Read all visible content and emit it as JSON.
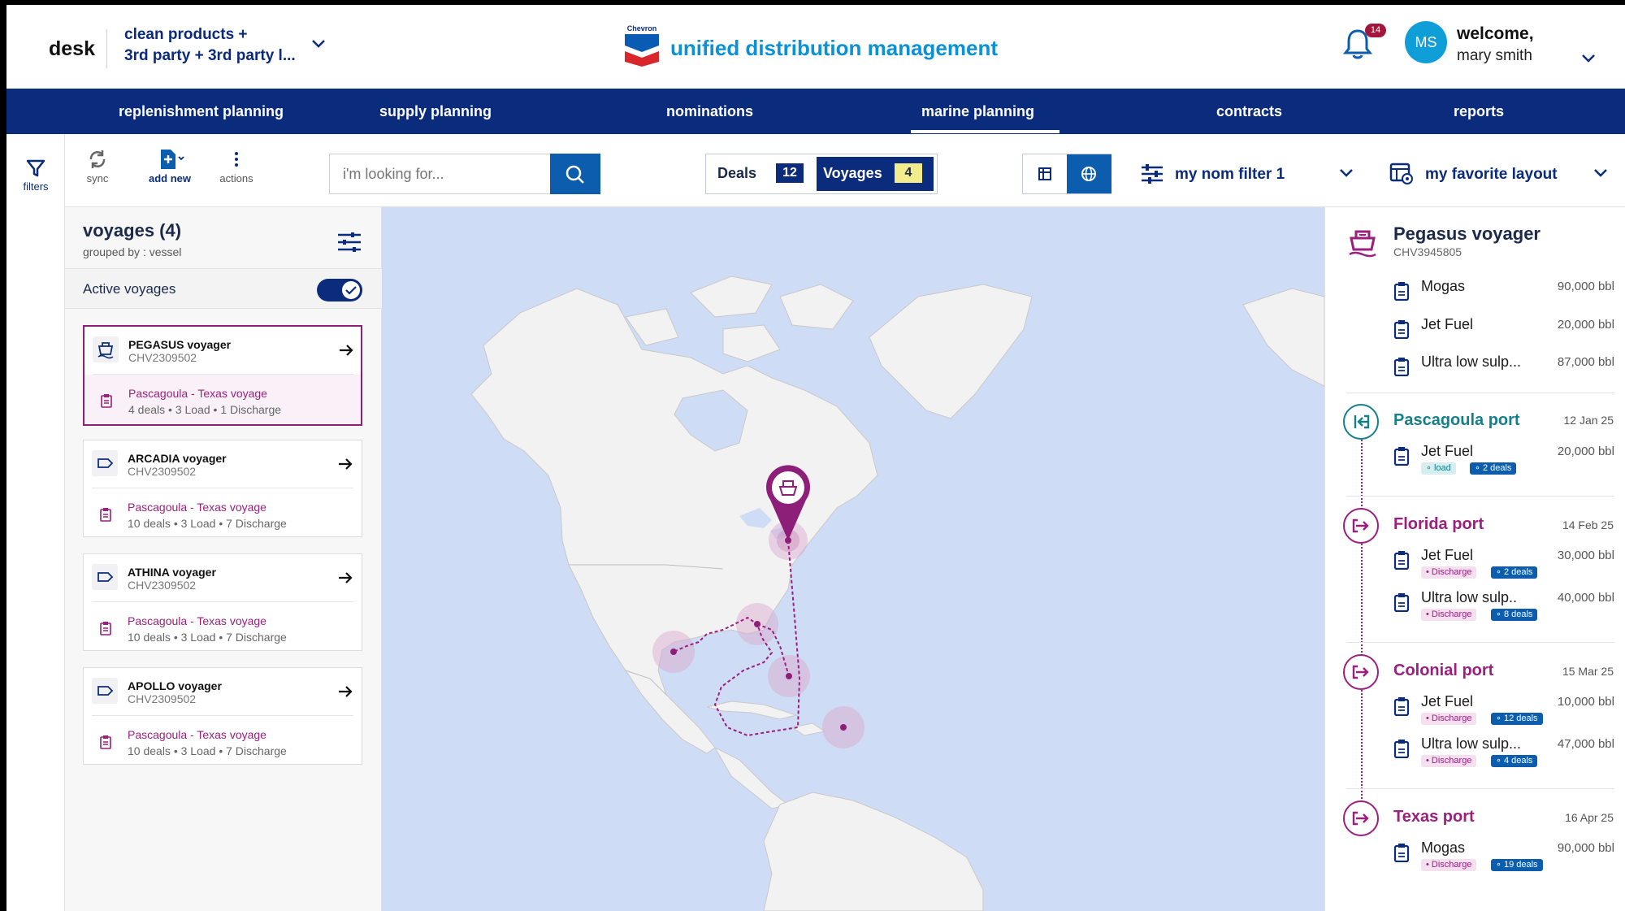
{
  "header": {
    "desk_label": "desk",
    "workspace_line1": "clean products +",
    "workspace_line2": "3rd party + 3rd party l...",
    "brand_small": "Chevron",
    "app_title": "unified distribution management",
    "notification_count": "14",
    "avatar_initials": "MS",
    "welcome_label": "welcome,",
    "user_name": "mary smith"
  },
  "nav": {
    "items": [
      {
        "label": "replenishment planning"
      },
      {
        "label": "supply planning"
      },
      {
        "label": "nominations"
      },
      {
        "label": "marine planning"
      },
      {
        "label": "contracts"
      },
      {
        "label": "reports"
      }
    ],
    "active": "marine planning"
  },
  "rail": {
    "filters_label": "filters"
  },
  "toolbar": {
    "sync_label": "sync",
    "add_new_label": "add new",
    "actions_label": "actions",
    "search_placeholder": "i'm looking for...",
    "deals_label": "Deals",
    "deals_count": "12",
    "voyages_label": "Voyages",
    "voyages_count": "4",
    "filter_label": "my nom filter 1",
    "layout_label": "my favorite layout"
  },
  "left_panel": {
    "title": "voyages (4)",
    "subtitle": "grouped by : vessel",
    "active_label": "Active voyages",
    "active_on": true,
    "voyages": [
      {
        "name": "PEGASUS voyager",
        "id": "CHV2309502",
        "route": "Pascagoula - Texas voyage",
        "meta": "4 deals • 3 Load • 1 Discharge",
        "selected": true
      },
      {
        "name": "ARCADIA voyager",
        "id": "CHV2309502",
        "route": "Pascagoula - Texas voyage",
        "meta": "10 deals • 3 Load • 7 Discharge",
        "selected": false
      },
      {
        "name": "ATHINA voyager",
        "id": "CHV2309502",
        "route": "Pascagoula - Texas voyage",
        "meta": "10 deals • 3 Load • 7 Discharge",
        "selected": false
      },
      {
        "name": "APOLLO voyager",
        "id": "CHV2309502",
        "route": "Pascagoula - Texas voyage",
        "meta": "10 deals • 3 Load • 7 Discharge",
        "selected": false
      }
    ]
  },
  "right_panel": {
    "vessel_name": "Pegasus voyager",
    "vessel_id": "CHV3945805",
    "cargo": [
      {
        "product": "Mogas",
        "qty": "90,000 bbl"
      },
      {
        "product": "Jet Fuel",
        "qty": "20,000 bbl"
      },
      {
        "product": "Ultra low sulp...",
        "qty": "87,000 bbl"
      }
    ],
    "ports": [
      {
        "name": "Pascagoula port",
        "date": "12 Jan 25",
        "type": "load",
        "items": [
          {
            "product": "Jet Fuel",
            "qty": "20,000 bbl",
            "tag": "load",
            "deals": "2 deals"
          }
        ]
      },
      {
        "name": "Florida port",
        "date": "14 Feb 25",
        "type": "discharge",
        "items": [
          {
            "product": "Jet Fuel",
            "qty": "30,000 bbl",
            "tag": "Discharge",
            "deals": "2 deals"
          },
          {
            "product": "Ultra low sulp..",
            "qty": "40,000 bbl",
            "tag": "Discharge",
            "deals": "8 deals"
          }
        ]
      },
      {
        "name": "Colonial port",
        "date": "15 Mar 25",
        "type": "discharge",
        "items": [
          {
            "product": "Jet Fuel",
            "qty": "10,000 bbl",
            "tag": "Discharge",
            "deals": "12 deals"
          },
          {
            "product": "Ultra low sulp...",
            "qty": "47,000 bbl",
            "tag": "Discharge",
            "deals": "4 deals"
          }
        ]
      },
      {
        "name": "Texas port",
        "date": "16 Apr 25",
        "type": "discharge",
        "items": [
          {
            "product": "Mogas",
            "qty": "90,000 bbl",
            "tag": "Discharge",
            "deals": "19 deals"
          }
        ]
      }
    ]
  },
  "colors": {
    "navy": "#0b2c7c",
    "brand_blue": "#0a91d6",
    "action_blue": "#0c5dad",
    "magenta": "#9b1f7f",
    "teal": "#157f8c",
    "map_water": "#cfdcf5",
    "map_land": "#f2f2f2"
  },
  "icons": [
    "filter-icon",
    "sync-icon",
    "add-new-icon",
    "actions-icon",
    "search-icon",
    "table-view-icon",
    "globe-view-icon",
    "sliders-icon",
    "layout-icon",
    "bell-icon",
    "ship-icon",
    "tag-icon",
    "clipboard-icon",
    "arrow-right-icon",
    "chevron-down-icon",
    "port-load-icon",
    "port-discharge-icon",
    "map-pin-icon"
  ]
}
